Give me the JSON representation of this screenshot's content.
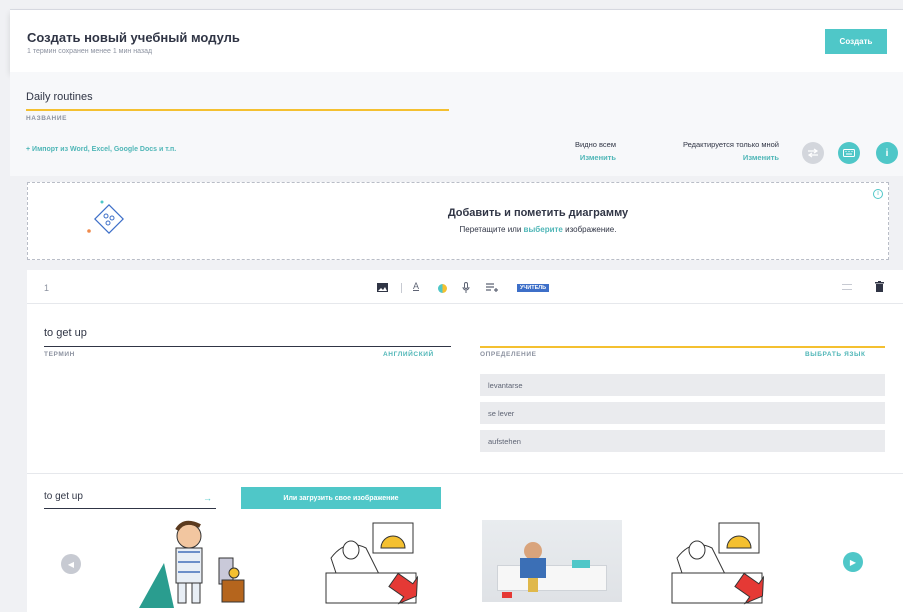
{
  "header": {
    "title": "Создать новый учебный модуль",
    "subtitle": "1 термин сохранен менее 1 мин назад",
    "create_label": "Создать"
  },
  "set": {
    "title_value": "Daily routines",
    "title_label": "НАЗВАНИЕ",
    "import_link": "+ Импорт из Word, Excel, Google Docs и т.п.",
    "visibility_label": "Видно всем",
    "visibility_change": "Изменить",
    "edit_label": "Редактируется только мной",
    "edit_change": "Изменить",
    "icons": [
      "swap-icon",
      "keyboard-icon",
      "info-icon"
    ]
  },
  "diagram": {
    "title": "Добавить и пометить диаграмму",
    "sub_before": "Перетащите или",
    "sub_link": "выберите",
    "sub_after": "изображение."
  },
  "card": {
    "number": "1",
    "toolbar_icons": [
      "image-icon",
      "text-format-icon",
      "color-icon",
      "microphone-icon",
      "add-list-icon"
    ],
    "teacher_badge": "УЧИТЕЛЬ",
    "term_value": "to get up",
    "term_label": "ТЕРМИН",
    "term_lang": "АНГЛИЙСКИЙ",
    "definition_label": "ОПРЕДЕЛЕНИЕ",
    "definition_lang": "ВЫБРАТЬ ЯЗЫК",
    "suggestions": [
      "levantarse",
      "se lever",
      "aufstehen"
    ],
    "image_search_value": "to get up",
    "upload_label": "Или загрузить свое изображение"
  },
  "colors": {
    "accent": "#4fc7c8",
    "highlight": "#f4c030",
    "badge": "#3d6fc8"
  }
}
